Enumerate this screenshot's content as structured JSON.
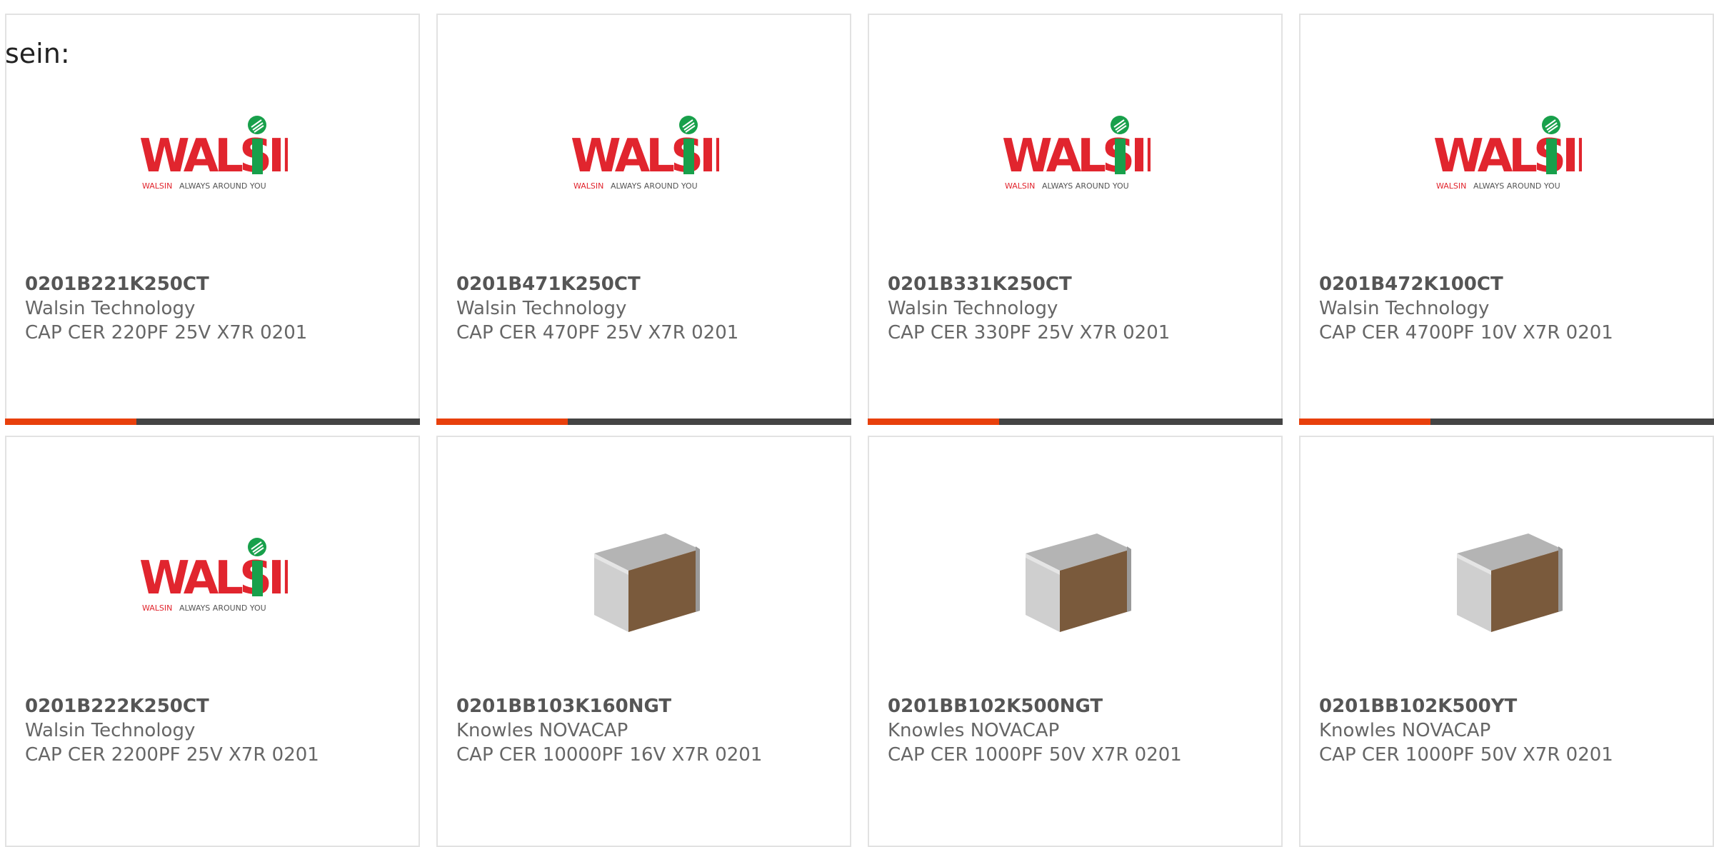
{
  "intro_text": "sein:",
  "colors": {
    "accent": "#E8400C",
    "bar": "#444444",
    "walsin_red": "#E1252E",
    "walsin_green": "#18A04B"
  },
  "logo": {
    "brand": "WALSIN",
    "tagline_brand": "WALSIN",
    "tagline": "ALWAYS AROUND YOU"
  },
  "products": [
    {
      "part": "0201B221K250CT",
      "manufacturer": "Walsin Technology",
      "description": "CAP CER 220PF 25V X7R 0201",
      "image": "walsin-logo"
    },
    {
      "part": "0201B471K250CT",
      "manufacturer": "Walsin Technology",
      "description": "CAP CER 470PF 25V X7R 0201",
      "image": "walsin-logo"
    },
    {
      "part": "0201B331K250CT",
      "manufacturer": "Walsin Technology",
      "description": "CAP CER 330PF 25V X7R 0201",
      "image": "walsin-logo"
    },
    {
      "part": "0201B472K100CT",
      "manufacturer": "Walsin Technology",
      "description": "CAP CER 4700PF 10V X7R 0201",
      "image": "walsin-logo"
    },
    {
      "part": "0201B222K250CT",
      "manufacturer": "Walsin Technology",
      "description": "CAP CER 2200PF 25V X7R 0201",
      "image": "walsin-logo"
    },
    {
      "part": "0201BB103K160NGT",
      "manufacturer": "Knowles NOVACAP",
      "description": "CAP CER 10000PF 16V X7R 0201",
      "image": "chip-capacitor"
    },
    {
      "part": "0201BB102K500NGT",
      "manufacturer": "Knowles NOVACAP",
      "description": "CAP CER 1000PF 50V X7R 0201",
      "image": "chip-capacitor"
    },
    {
      "part": "0201BB102K500YT",
      "manufacturer": "Knowles NOVACAP",
      "description": "CAP CER 1000PF 50V X7R 0201",
      "image": "chip-capacitor"
    }
  ]
}
